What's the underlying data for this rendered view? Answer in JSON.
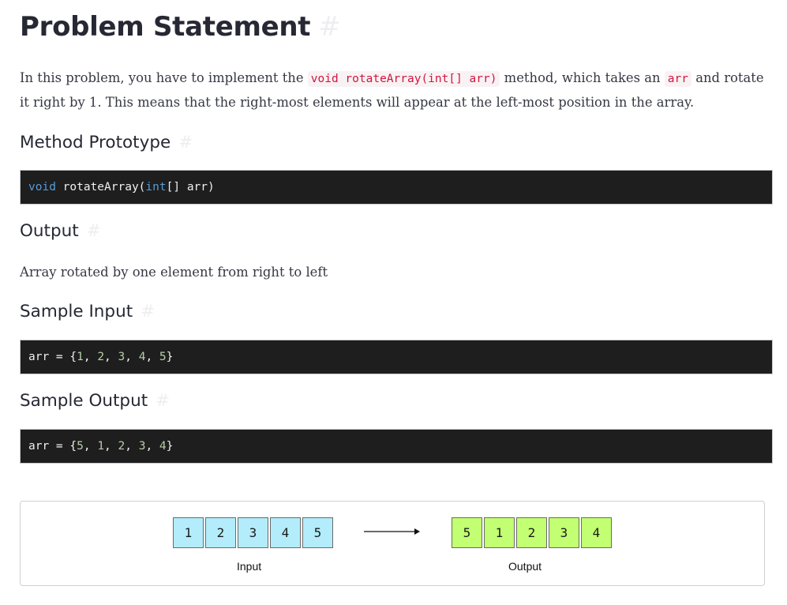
{
  "title": "Problem Statement",
  "anchor_symbol": "#",
  "intro": {
    "text_before": "In this problem, you have to implement the ",
    "code_method": "void rotateArray(int[] arr)",
    "text_middle": " method, which takes an ",
    "code_arr": "arr",
    "text_after": " and rotate it right by 1. This means that the right-most elements will appear at the left-most position in the array."
  },
  "sections": {
    "method_prototype": {
      "heading": "Method Prototype",
      "code": {
        "kw1": "void",
        "name": " rotateArray(",
        "kw2": "int",
        "rest": "[] arr)"
      }
    },
    "output": {
      "heading": "Output",
      "text": "Array rotated by one element from right to left"
    },
    "sample_input": {
      "heading": "Sample Input",
      "prefix": "arr = {",
      "values": [
        "1",
        "2",
        "3",
        "4",
        "5"
      ],
      "suffix": "}"
    },
    "sample_output": {
      "heading": "Sample Output",
      "prefix": "arr = {",
      "values": [
        "5",
        "1",
        "2",
        "3",
        "4"
      ],
      "suffix": "}"
    }
  },
  "diagram": {
    "input_label": "Input",
    "output_label": "Output",
    "input_cells": [
      "1",
      "2",
      "3",
      "4",
      "5"
    ],
    "output_cells": [
      "5",
      "1",
      "2",
      "3",
      "4"
    ],
    "colors": {
      "input": "#b3ecfa",
      "output": "#c3ff72"
    }
  }
}
